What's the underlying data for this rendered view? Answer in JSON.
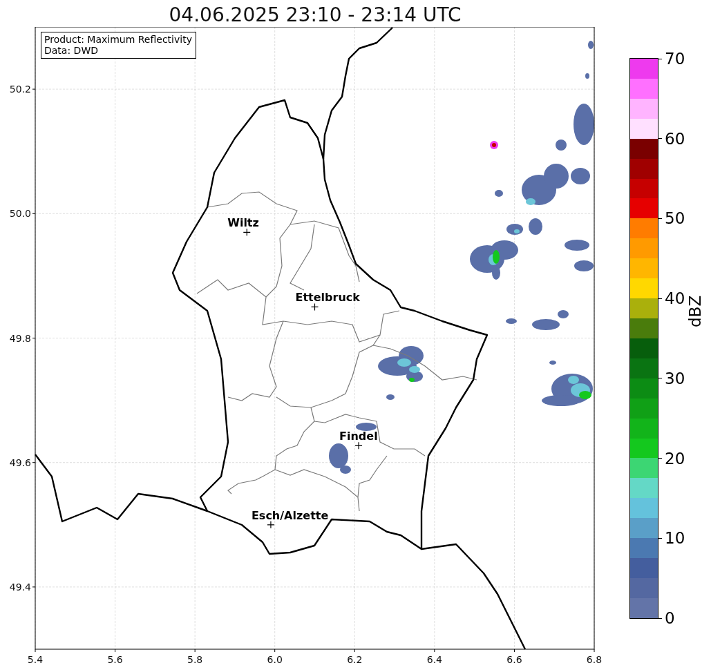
{
  "radar_map": {
    "chart_data": {
      "type": "scatter",
      "title": "04.06.2025 23:10 - 23:14 UTC",
      "x": [
        5.93,
        6.1,
        6.21,
        5.99
      ],
      "series": [
        {
          "values": [
            49.97,
            49.85,
            49.627,
            49.5
          ]
        }
      ],
      "grid": true,
      "xlim": [
        5.4,
        6.8
      ],
      "ylim": [
        49.3,
        50.3
      ],
      "xticks": [
        {
          "value": 5.4,
          "label": "5.4"
        },
        {
          "value": 5.6,
          "label": "5.6"
        },
        {
          "value": 5.8,
          "label": "5.8"
        },
        {
          "value": 6.0,
          "label": "6.0"
        },
        {
          "value": 6.2,
          "label": "6.2"
        },
        {
          "value": 6.4,
          "label": "6.4"
        },
        {
          "value": 6.6,
          "label": "6.6"
        },
        {
          "value": 6.8,
          "label": "6.8"
        }
      ],
      "yticks": [
        {
          "value": 49.4,
          "label": "49.4"
        },
        {
          "value": 49.6,
          "label": "49.6"
        },
        {
          "value": 49.8,
          "label": "49.8"
        },
        {
          "value": 50.0,
          "label": "50.0"
        },
        {
          "value": 50.2,
          "label": "50.2"
        }
      ],
      "annotations": [
        {
          "text": "Wiltz",
          "x": 5.93,
          "y": 49.97
        },
        {
          "text": "Ettelbruck",
          "x": 6.1,
          "y": 49.85
        },
        {
          "text": "Findel",
          "x": 6.21,
          "y": 49.627
        },
        {
          "text": "Esch/Alzette",
          "x": 5.99,
          "y": 49.5
        }
      ]
    },
    "info_box": {
      "lines": [
        "Product: Maximum Reflectivity",
        "Data: DWD"
      ]
    }
  },
  "colorbar": {
    "label": "dBZ",
    "ticks": [
      "70",
      "60",
      "50",
      "40",
      "30",
      "20",
      "10",
      "0"
    ],
    "steps": [
      {
        "color": "#ee3aee"
      },
      {
        "color": "#ff70ff"
      },
      {
        "color": "#ffb4ff"
      },
      {
        "color": "#ffe0ff"
      },
      {
        "color": "#7a0000"
      },
      {
        "color": "#a00000"
      },
      {
        "color": "#c60000"
      },
      {
        "color": "#e60000"
      },
      {
        "color": "#ff7c00"
      },
      {
        "color": "#ff9a00"
      },
      {
        "color": "#ffb600"
      },
      {
        "color": "#ffd800"
      },
      {
        "color": "#aab00c"
      },
      {
        "color": "#4a7c0c"
      },
      {
        "color": "#075e0c"
      },
      {
        "color": "#0a7412"
      },
      {
        "color": "#0c8c14"
      },
      {
        "color": "#10a016"
      },
      {
        "color": "#12b41a"
      },
      {
        "color": "#14c81e"
      },
      {
        "color": "#3cd673"
      },
      {
        "color": "#64d8c6"
      },
      {
        "color": "#64c2dc"
      },
      {
        "color": "#5a9fc8"
      },
      {
        "color": "#4b79b1"
      },
      {
        "color": "#445e9e"
      },
      {
        "color": "#5468a1"
      },
      {
        "color": "#6374a8"
      }
    ]
  }
}
